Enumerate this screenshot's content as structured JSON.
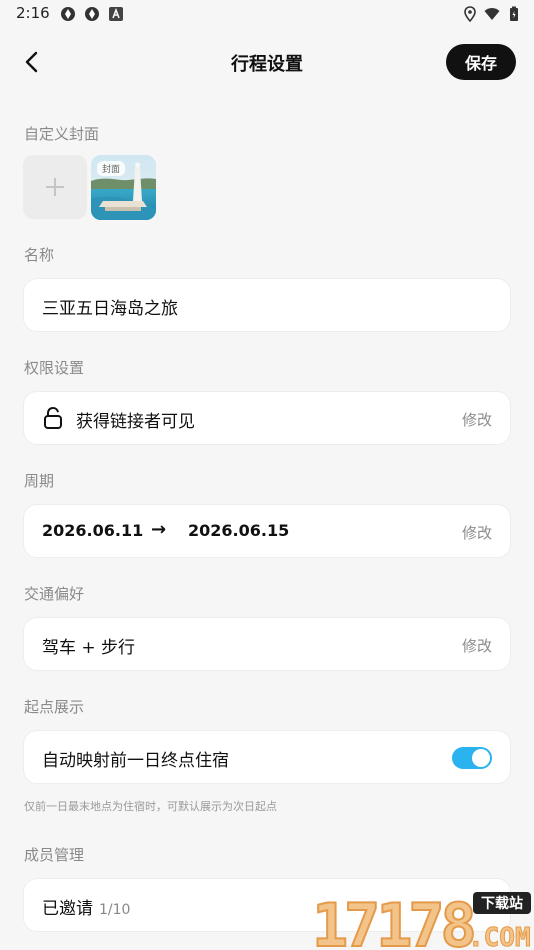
{
  "status_bar": {
    "time": "2:16"
  },
  "header": {
    "title": "行程设置",
    "save_label": "保存"
  },
  "cover": {
    "label": "自定义封面",
    "thumb_tag": "封面"
  },
  "name": {
    "label": "名称",
    "value": "三亚五日海岛之旅"
  },
  "permission": {
    "label": "权限设置",
    "value": "获得链接者可见",
    "modify": "修改"
  },
  "period": {
    "label": "周期",
    "start": "2026.06.11",
    "arrow": "→",
    "end": "2026.06.15",
    "modify": "修改"
  },
  "transport": {
    "label": "交通偏好",
    "value": "驾车 + 步行",
    "modify": "修改"
  },
  "start_point": {
    "label": "起点展示",
    "value": "自动映射前一日终点住宿",
    "toggle_on": true,
    "hint": "仅前一日最末地点为住宿时，可默认展示为次日起点"
  },
  "members": {
    "label": "成员管理",
    "value": "已邀请",
    "count": "1/10"
  },
  "watermark": {
    "number": "17178",
    "tag": "下载站",
    "domain": ".COM"
  },
  "colors": {
    "toggle_accent": "#2bb3ef",
    "save_bg": "#111111"
  }
}
